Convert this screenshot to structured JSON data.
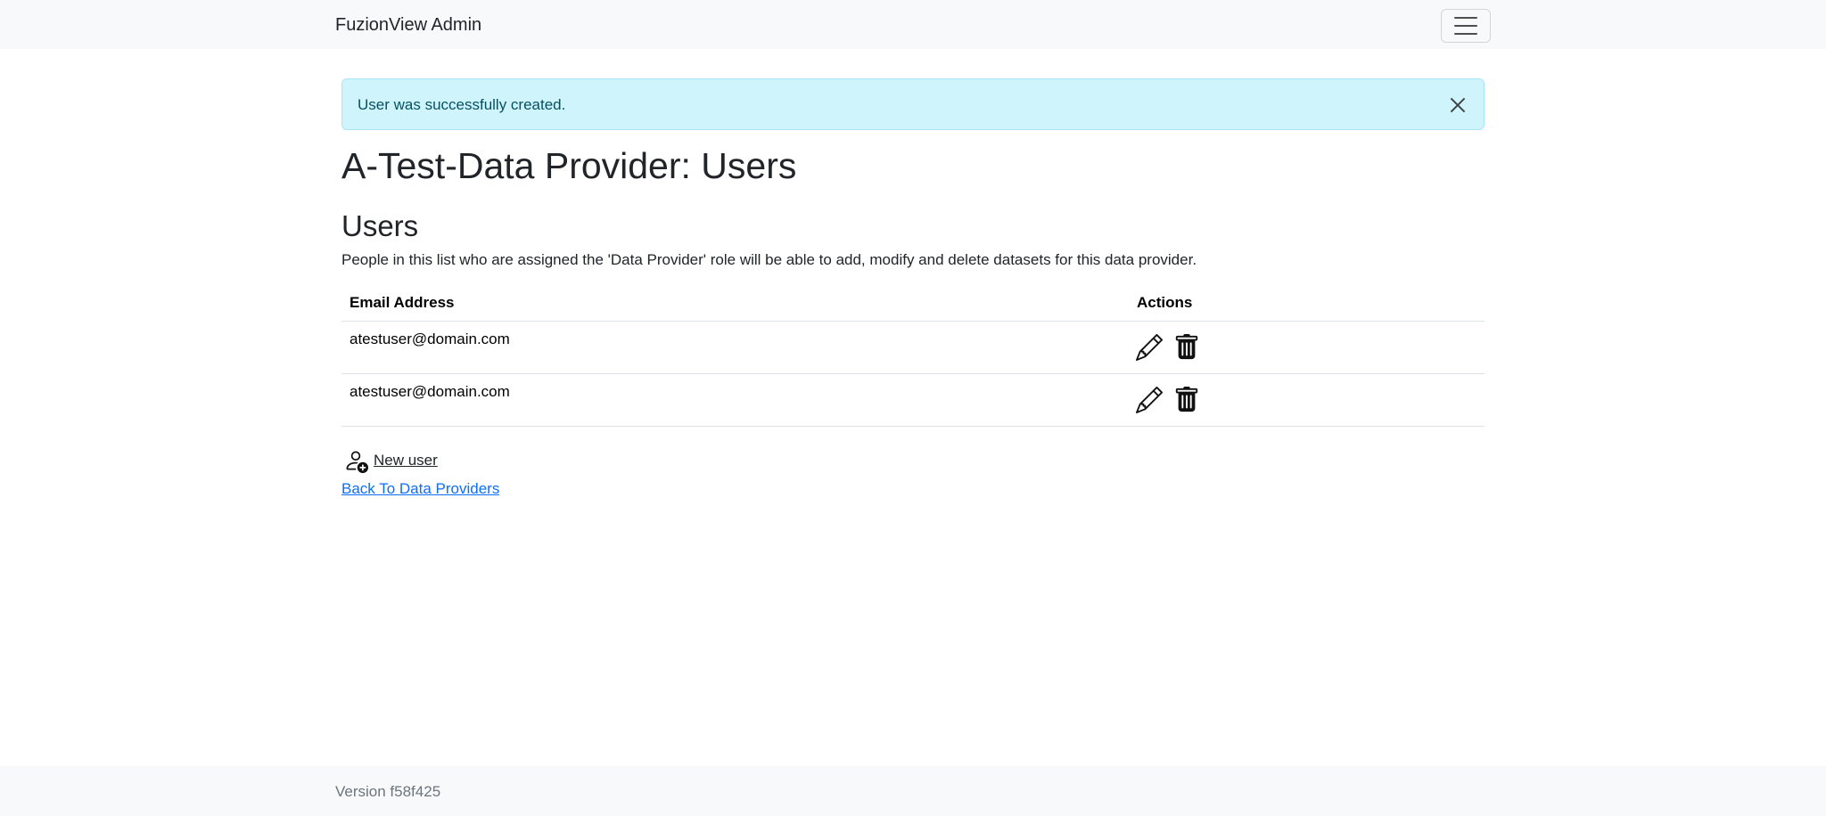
{
  "navbar": {
    "brand": "FuzionView Admin",
    "toggler_icon": "hamburger-menu-icon"
  },
  "alert": {
    "message": "User was successfully created.",
    "close_icon": "close-icon"
  },
  "page": {
    "title": "A-Test-Data Provider: Users"
  },
  "users_section": {
    "heading": "Users",
    "description": "People in this list who are assigned the 'Data Provider' role will be able to add, modify and delete datasets for this data provider.",
    "columns": [
      "Email Address",
      "Actions"
    ],
    "rows": [
      {
        "email": "atestuser@domain.com",
        "actions": [
          "pencil-icon",
          "trash-icon"
        ]
      },
      {
        "email": "atestuser@domain.com",
        "actions": [
          "pencil-icon",
          "trash-icon"
        ]
      }
    ]
  },
  "links": {
    "new_user": "New user",
    "new_user_icon": "person-add-icon",
    "back": "Back To Data Providers"
  },
  "footer": {
    "version": "Version f58f425"
  },
  "colors": {
    "alert_bg": "#cff4fc",
    "alert_text": "#055160",
    "link": "#0d6efd",
    "navbar_bg": "#f8f9fa"
  }
}
